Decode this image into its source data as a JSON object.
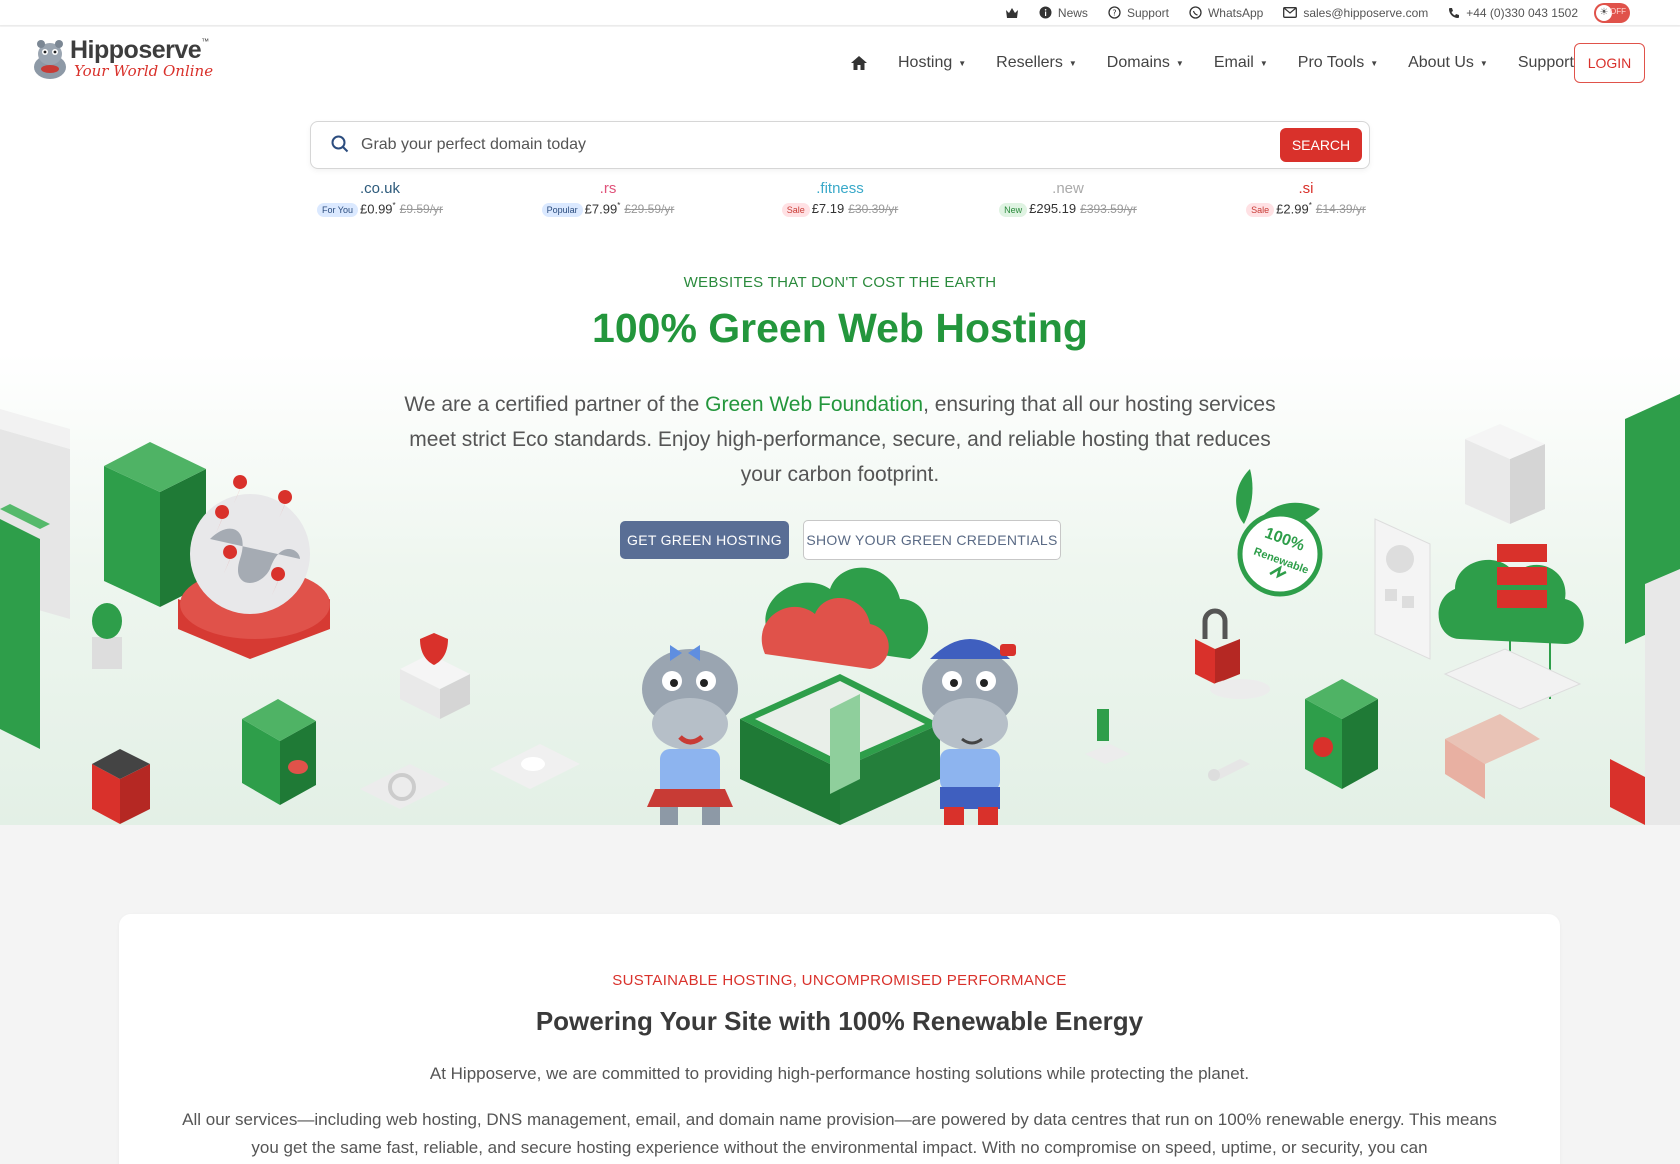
{
  "topbar": {
    "news": "News",
    "support": "Support",
    "whatsapp": "WhatsApp",
    "email": "sales@hipposerve.com",
    "phone": "+44 (0)330 043 1502",
    "theme_toggle": "OFF"
  },
  "logo": {
    "brand": "Hipposerve",
    "tm": "™",
    "tagline": "Your World Online"
  },
  "nav": {
    "items": [
      {
        "label": "Hosting"
      },
      {
        "label": "Resellers"
      },
      {
        "label": "Domains"
      },
      {
        "label": "Email"
      },
      {
        "label": "Pro Tools"
      },
      {
        "label": "About Us"
      },
      {
        "label": "Support"
      }
    ],
    "login": "LOGIN"
  },
  "search": {
    "placeholder": "Grab your perfect domain today",
    "button": "SEARCH"
  },
  "tlds": [
    {
      "name": ".co.uk",
      "badge": "For You",
      "badge_color": "#dbe9ff",
      "price": "£0.99",
      "old": "£9.59/yr"
    },
    {
      "name": ".rs",
      "badge": "Popular",
      "badge_color": "#dbe9ff",
      "price": "£7.99",
      "old": "£29.59/yr"
    },
    {
      "name": ".fitness",
      "badge": "Sale",
      "badge_color": "#ffe1e4",
      "price": "£7.19",
      "old": "£30.39/yr"
    },
    {
      "name": ".new",
      "badge": "New",
      "badge_color": "#dff3e2",
      "price": "£295.19",
      "old": "£393.59/yr"
    },
    {
      "name": ".si",
      "badge": "Sale",
      "badge_color": "#ffe1e4",
      "price": "£2.99",
      "old": "£14.39/yr"
    }
  ],
  "hero": {
    "kicker": "WEBSITES THAT DON'T COST THE EARTH",
    "title": "100% Green Web Hosting",
    "desc_pre": "We are a certified partner of the ",
    "desc_link": "Green Web Foundation",
    "desc_post": ", ensuring that all our hosting services meet strict Eco standards. Enjoy high-performance, secure, and reliable hosting that reduces your carbon footprint.",
    "btn_primary": "GET GREEN HOSTING",
    "btn_secondary": "SHOW YOUR GREEN CREDENTIALS",
    "seal_line1": "100%",
    "seal_line2": "Renewable"
  },
  "section": {
    "kicker": "SUSTAINABLE HOSTING, UNCOMPROMISED PERFORMANCE",
    "title": "Powering Your Site with 100% Renewable Energy",
    "p1": "At Hipposerve, we are committed to providing high-performance hosting solutions while protecting the planet.",
    "p2": "All our services—including web hosting, DNS management, email, and domain name provision—are powered by data centres that run on 100% renewable energy. This means you get the same fast, reliable, and secure hosting experience without the environmental impact. With no compromise on speed, uptime, or security, you can"
  },
  "colors": {
    "green": "#23963c",
    "red": "#d9312b",
    "blue_button": "#596e95"
  }
}
